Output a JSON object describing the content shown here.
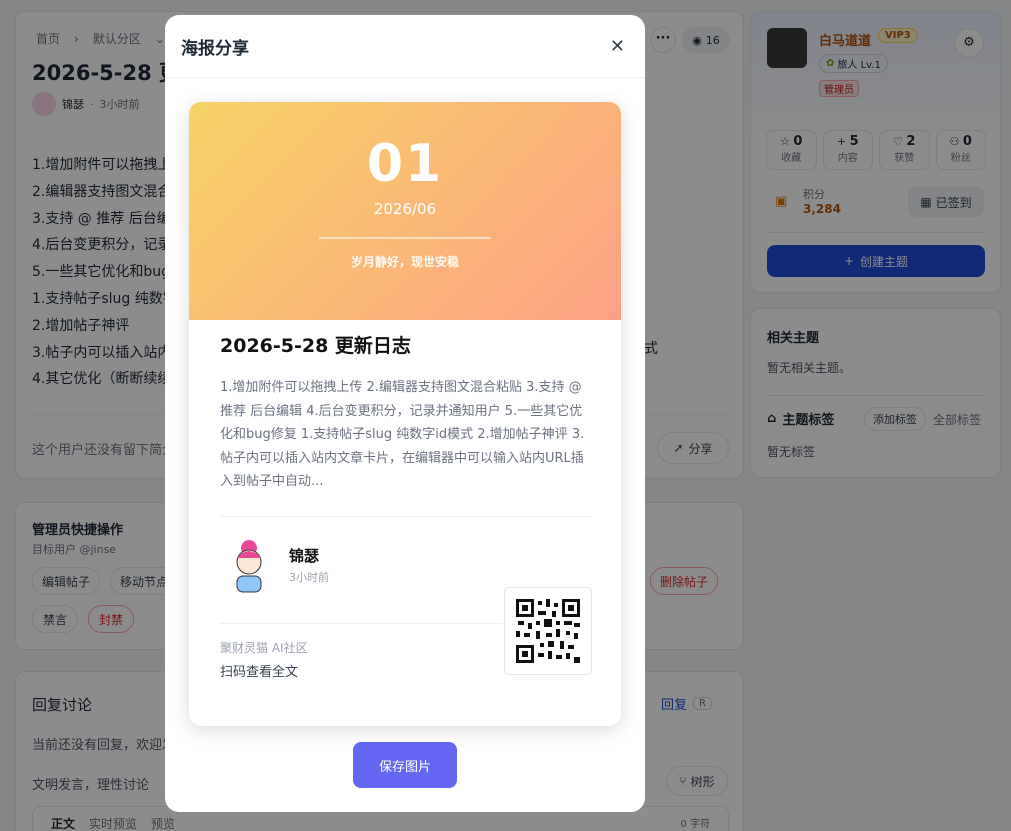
{
  "breadcrumb": {
    "home": "首页",
    "section": "默认分区"
  },
  "post": {
    "title": "2026-5-28 更新日志",
    "author": "锦瑟",
    "time": "3小时前",
    "views": "16",
    "lines": [
      "1.增加附件可以拖拽上传",
      "2.编辑器支持图文混合粘贴",
      "3.支持 @ 推荐 后台编辑",
      "4.后台变更积分，记录并通知用户",
      "5.一些其它优化和bug修复",
      "1.支持帖子slug 纯数字id模式",
      "2.增加帖子神评",
      "3.帖子内可以插入站内文章卡片，在编辑器中可以输入站内URL插入到帖子中自动识别为卡片模式",
      "4.其它优化（断断续续的小修复）"
    ],
    "line8_tail": "式",
    "no_sign": "这个用户还没有留下简介",
    "share": "分享"
  },
  "admin": {
    "title": "管理员快捷操作",
    "target": "目标用户 @jinse",
    "edit": "编辑帖子",
    "move": "移动节点",
    "delete": "删除帖子",
    "mute": "禁言",
    "ban": "封禁"
  },
  "reply": {
    "title": "回复讨论",
    "empty": "当前还没有回复，欢迎发表你的看法",
    "reply_link": "回复",
    "reply_key": "R",
    "civil": "文明发言，理性讨论",
    "tree": "树形",
    "tab_text": "正文",
    "tab_live": "实时预览",
    "tab_preview": "预览",
    "count": "0 字符"
  },
  "user": {
    "name": "白马道道",
    "vip": "VIP3",
    "level": "旅人 Lv.1",
    "role": "管理员",
    "stats": [
      {
        "num": "0",
        "label": "收藏",
        "icon": "star-icon"
      },
      {
        "num": "5",
        "label": "内容",
        "icon": "plus-icon"
      },
      {
        "num": "2",
        "label": "获赞",
        "icon": "heart-icon"
      },
      {
        "num": "0",
        "label": "粉丝",
        "icon": "users-icon"
      }
    ],
    "points_label": "积分",
    "points": "3,284",
    "checked_in": "已签到",
    "create_topic": "创建主题"
  },
  "related": {
    "title": "相关主题",
    "empty": "暂无相关主题。",
    "tags_title": "主题标签",
    "add_tag": "添加标签",
    "all_tags": "全部标签",
    "no_tags": "暂无标签"
  },
  "modal": {
    "title": "海报分享",
    "day": "01",
    "month": "2026/06",
    "motto": "岁月静好，现世安稳",
    "post_title": "2026-5-28 更新日志",
    "excerpt": "1.增加附件可以拖拽上传 2.编辑器支持图文混合粘贴 3.支持 @ 推荐 后台编辑 4.后台变更积分，记录并通知用户 5.一些其它优化和bug修复 1.支持帖子slug 纯数字id模式 2.增加帖子神评 3.帖子内可以插入站内文章卡片，在编辑器中可以输入站内URL插入到帖子中自动...",
    "author": "锦瑟",
    "time": "3小时前",
    "site": "聚财灵猫 AI社区",
    "scan": "扫码查看全文",
    "save": "保存图片"
  },
  "colors": {
    "accent": "#6366f1",
    "brand_blue": "#1d4ed8",
    "danger": "#dc2626",
    "vip": "#b45309"
  }
}
